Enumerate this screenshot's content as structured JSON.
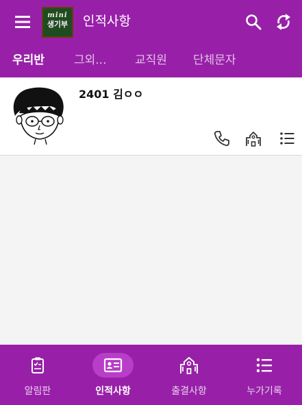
{
  "app": {
    "title": "인적사항",
    "logo_line1": "mini",
    "logo_line2": "생기부"
  },
  "tabs": [
    {
      "label": "우리반",
      "active": true
    },
    {
      "label": "그외...",
      "active": false
    },
    {
      "label": "교직원",
      "active": false
    },
    {
      "label": "단체문자",
      "active": false
    }
  ],
  "students": [
    {
      "name": "2401 김ㅇㅇ",
      "actions": [
        "phone-icon",
        "school-icon",
        "list-icon"
      ]
    }
  ],
  "bottom_nav": [
    {
      "label": "알림판",
      "icon": "clipboard-icon",
      "active": false
    },
    {
      "label": "인적사항",
      "icon": "id-card-icon",
      "active": true
    },
    {
      "label": "출결사항",
      "icon": "school-clock-icon",
      "active": false
    },
    {
      "label": "누가기록",
      "icon": "list-icon",
      "active": false
    }
  ],
  "colors": {
    "primary": "#9820a8",
    "active_pill": "#b83dc8",
    "background": "#f4f4f4",
    "card": "#ffffff"
  }
}
